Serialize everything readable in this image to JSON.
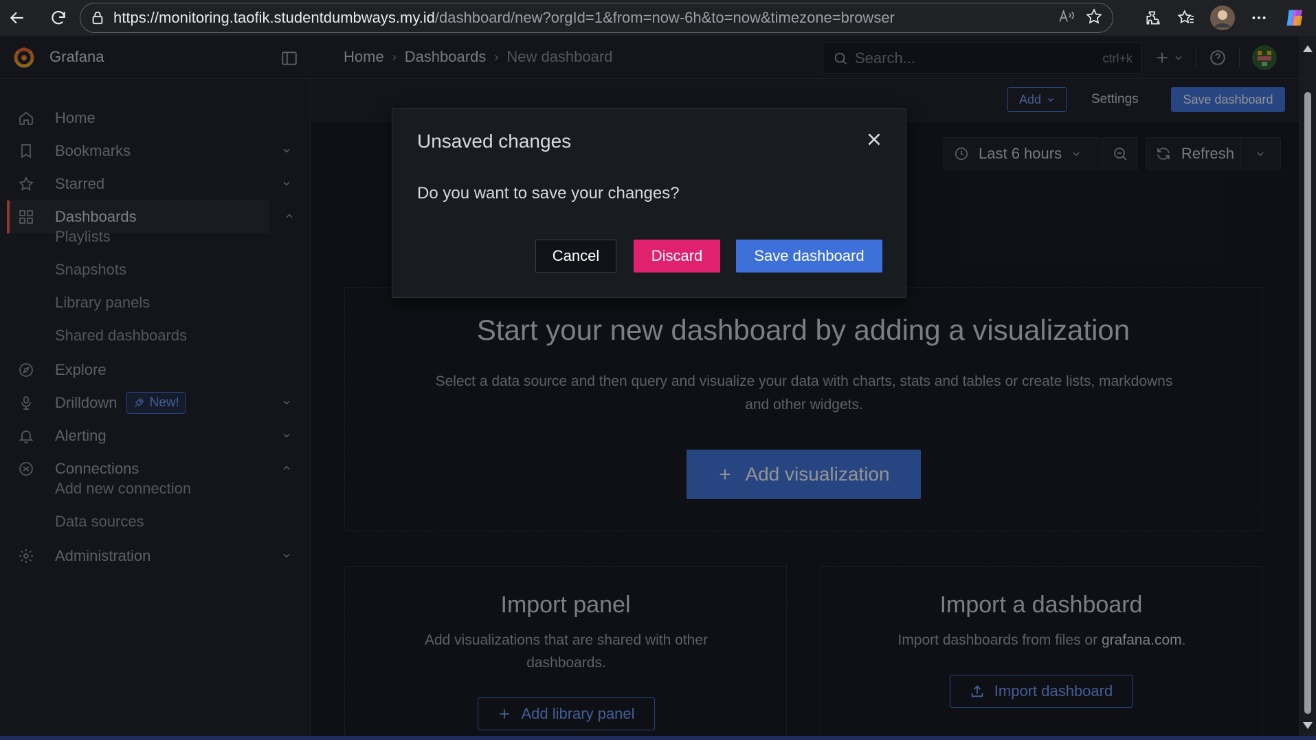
{
  "browser": {
    "url_host": "https://monitoring.taofik.studentdumbways.my.id",
    "url_path": "/dashboard/new?orgId=1&from=now-6h&to=now&timezone=browser"
  },
  "topbar": {
    "brand": "Grafana",
    "breadcrumbs": [
      "Home",
      "Dashboards",
      "New dashboard"
    ],
    "search_placeholder": "Search...",
    "search_shortcut": "ctrl+k"
  },
  "sidebar": {
    "items": [
      {
        "label": "Home",
        "icon": "home-icon"
      },
      {
        "label": "Bookmarks",
        "icon": "bookmark-icon",
        "chevron": "down"
      },
      {
        "label": "Starred",
        "icon": "star-icon",
        "chevron": "down"
      },
      {
        "label": "Dashboards",
        "icon": "apps-icon",
        "chevron": "up",
        "active": true
      },
      {
        "label": "Explore",
        "icon": "compass-icon"
      },
      {
        "label": "Drilldown",
        "icon": "drilldown-icon",
        "chevron": "down",
        "badge": "New!"
      },
      {
        "label": "Alerting",
        "icon": "bell-icon",
        "chevron": "down"
      },
      {
        "label": "Connections",
        "icon": "connections-icon",
        "chevron": "up"
      },
      {
        "label": "Administration",
        "icon": "cog-icon",
        "chevron": "down"
      }
    ],
    "dashboards_sub": [
      "Playlists",
      "Snapshots",
      "Library panels",
      "Shared dashboards"
    ],
    "connections_sub": [
      "Add new connection",
      "Data sources"
    ]
  },
  "toolbar": {
    "add_label": "Add",
    "settings_label": "Settings",
    "save_label": "Save dashboard",
    "time_range": "Last 6 hours",
    "refresh_label": "Refresh"
  },
  "empty_state": {
    "title": "Start your new dashboard by adding a visualization",
    "description": "Select a data source and then query and visualize your data with charts, stats and tables or create lists, markdowns and other widgets.",
    "button": "Add visualization"
  },
  "import_panel": {
    "title": "Import panel",
    "description": "Add visualizations that are shared with other dashboards.",
    "button": "Add library panel"
  },
  "import_dashboard": {
    "title": "Import a dashboard",
    "description_prefix": "Import dashboards from files or ",
    "description_link": "grafana.com",
    "description_suffix": ".",
    "button": "Import dashboard"
  },
  "modal": {
    "title": "Unsaved changes",
    "body": "Do you want to save your changes?",
    "cancel": "Cancel",
    "discard": "Discard",
    "save": "Save dashboard"
  },
  "colors": {
    "accent": "#3d71d9",
    "discard": "#e0226e",
    "active_indicator": "#f55f3e",
    "background": "#111217",
    "panel": "#181b1f"
  }
}
